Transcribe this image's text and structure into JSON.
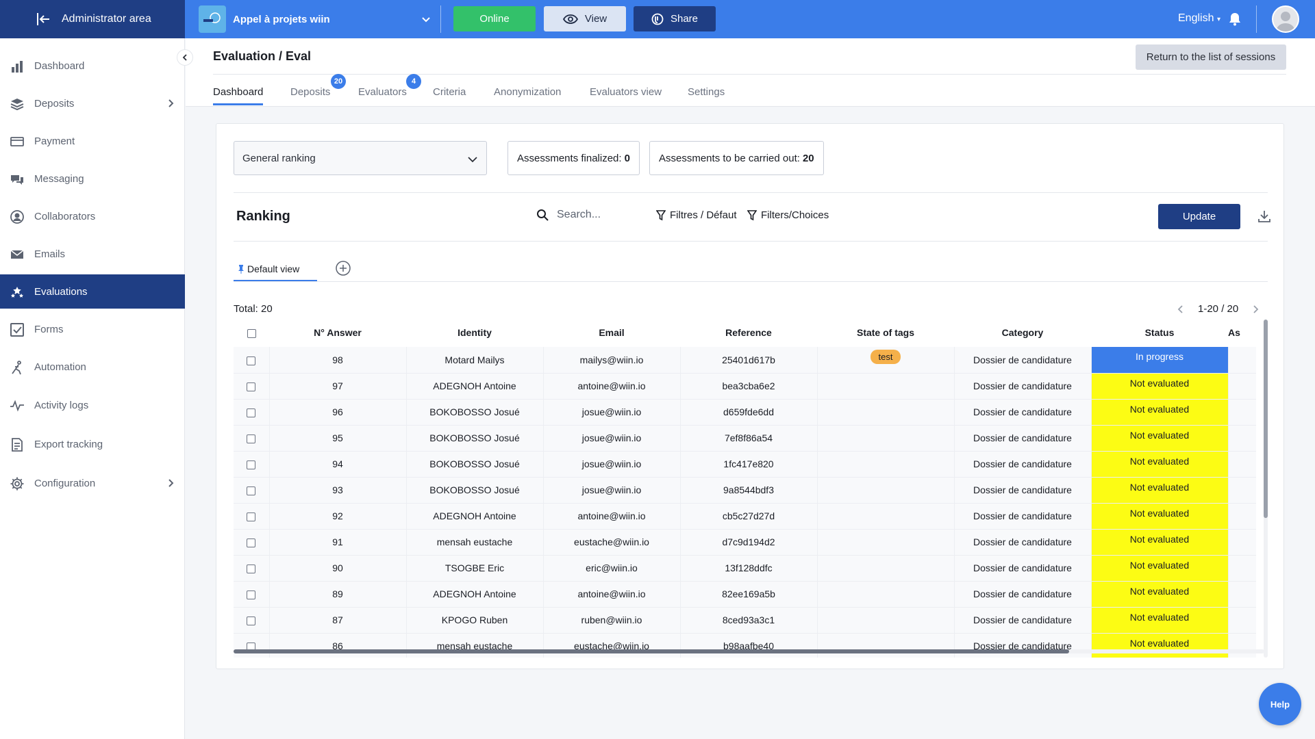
{
  "topbar": {
    "admin_label": "Administrator area",
    "project_name": "Appel à projets wiin",
    "online_label": "Online",
    "view_label": "View",
    "share_label": "Share",
    "language": "English",
    "accent": "#3b7de9",
    "dark": "#1f3e84"
  },
  "sidebar": {
    "items": [
      {
        "label": "Dashboard",
        "icon": "bar-chart-icon"
      },
      {
        "label": "Deposits",
        "icon": "layers-icon"
      },
      {
        "label": "Payment",
        "icon": "credit-card-icon"
      },
      {
        "label": "Messaging",
        "icon": "chat-icon"
      },
      {
        "label": "Collaborators",
        "icon": "user-circle-icon"
      },
      {
        "label": "Emails",
        "icon": "envelope-icon"
      },
      {
        "label": "Evaluations",
        "icon": "stars-icon"
      },
      {
        "label": "Forms",
        "icon": "checkbox-icon"
      },
      {
        "label": "Automation",
        "icon": "automation-icon"
      },
      {
        "label": "Activity logs",
        "icon": "pulse-icon"
      },
      {
        "label": "Export tracking",
        "icon": "document-icon"
      },
      {
        "label": "Configuration",
        "icon": "gear-icon"
      }
    ]
  },
  "header": {
    "title": "Evaluation / Eval",
    "return_label": "Return to the list of sessions",
    "tabs": [
      {
        "label": "Dashboard"
      },
      {
        "label": "Deposits",
        "badge": "20"
      },
      {
        "label": "Evaluators",
        "badge": "4"
      },
      {
        "label": "Criteria"
      },
      {
        "label": "Anonymization"
      },
      {
        "label": "Evaluators view"
      },
      {
        "label": "Settings"
      }
    ]
  },
  "main": {
    "ranking_select": "General ranking",
    "finalized_label": "Assessments finalized:",
    "finalized_value": "0",
    "todo_label": "Assessments to be carried out:",
    "todo_value": "20",
    "ranking_title": "Ranking",
    "search_placeholder": "Search...",
    "filter_default": "Filtres / Défaut",
    "filter_choices": "Filters/Choices",
    "update_label": "Update",
    "view_tab": "Default view",
    "total": "Total: 20",
    "pager": "1-20 / 20"
  },
  "table": {
    "headers": [
      "N° Answer",
      "Identity",
      "Email",
      "Reference",
      "State of tags",
      "Category",
      "Status",
      "As"
    ],
    "rows": [
      {
        "n": "98",
        "identity": "Motard Mailys",
        "email": "mailys@wiin.io",
        "ref": "25401d617b",
        "tag": "test",
        "category": "Dossier de candidature",
        "status": "In progress"
      },
      {
        "n": "97",
        "identity": "ADEGNOH Antoine",
        "email": "antoine@wiin.io",
        "ref": "bea3cba6e2",
        "tag": "",
        "category": "Dossier de candidature",
        "status": "Not evaluated"
      },
      {
        "n": "96",
        "identity": "BOKOBOSSO Josué",
        "email": "josue@wiin.io",
        "ref": "d659fde6dd",
        "tag": "",
        "category": "Dossier de candidature",
        "status": "Not evaluated"
      },
      {
        "n": "95",
        "identity": "BOKOBOSSO Josué",
        "email": "josue@wiin.io",
        "ref": "7ef8f86a54",
        "tag": "",
        "category": "Dossier de candidature",
        "status": "Not evaluated"
      },
      {
        "n": "94",
        "identity": "BOKOBOSSO Josué",
        "email": "josue@wiin.io",
        "ref": "1fc417e820",
        "tag": "",
        "category": "Dossier de candidature",
        "status": "Not evaluated"
      },
      {
        "n": "93",
        "identity": "BOKOBOSSO Josué",
        "email": "josue@wiin.io",
        "ref": "9a8544bdf3",
        "tag": "",
        "category": "Dossier de candidature",
        "status": "Not evaluated"
      },
      {
        "n": "92",
        "identity": "ADEGNOH Antoine",
        "email": "antoine@wiin.io",
        "ref": "cb5c27d27d",
        "tag": "",
        "category": "Dossier de candidature",
        "status": "Not evaluated"
      },
      {
        "n": "91",
        "identity": "mensah eustache",
        "email": "eustache@wiin.io",
        "ref": "d7c9d194d2",
        "tag": "",
        "category": "Dossier de candidature",
        "status": "Not evaluated"
      },
      {
        "n": "90",
        "identity": "TSOGBE Eric",
        "email": "eric@wiin.io",
        "ref": "13f128ddfc",
        "tag": "",
        "category": "Dossier de candidature",
        "status": "Not evaluated"
      },
      {
        "n": "89",
        "identity": "ADEGNOH Antoine",
        "email": "antoine@wiin.io",
        "ref": "82ee169a5b",
        "tag": "",
        "category": "Dossier de candidature",
        "status": "Not evaluated"
      },
      {
        "n": "87",
        "identity": "KPOGO Ruben",
        "email": "ruben@wiin.io",
        "ref": "8ced93a3c1",
        "tag": "",
        "category": "Dossier de candidature",
        "status": "Not evaluated"
      },
      {
        "n": "86",
        "identity": "mensah eustache",
        "email": "eustache@wiin.io",
        "ref": "b98aafbe40",
        "tag": "",
        "category": "Dossier de candidature",
        "status": "Not evaluated"
      }
    ]
  },
  "help_label": "Help"
}
